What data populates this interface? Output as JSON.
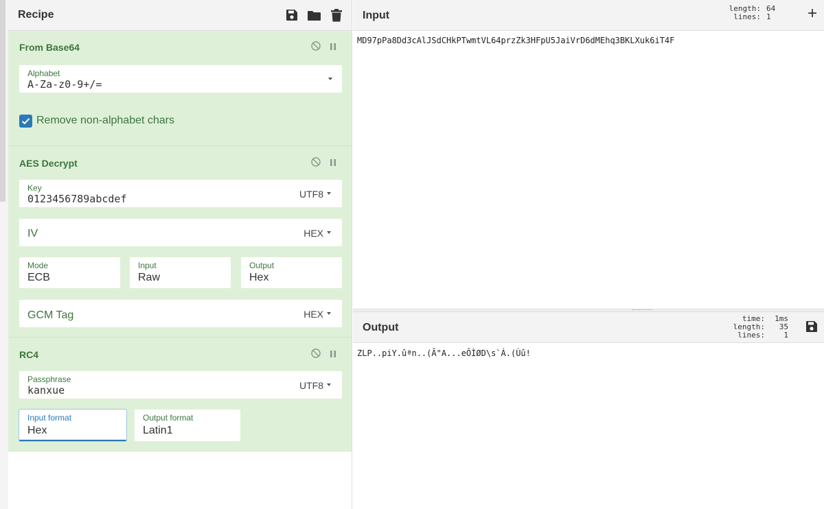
{
  "recipe": {
    "title": "Recipe",
    "header_icons": [
      "save-icon",
      "folder-icon",
      "trash-icon"
    ],
    "operations": {
      "from_base64": {
        "title": "From Base64",
        "alphabet_label": "Alphabet",
        "alphabet_value": "A-Za-z0-9+/=",
        "remove_nonalpha_label": "Remove non-alphabet chars",
        "remove_nonalpha_checked": true
      },
      "aes_decrypt": {
        "title": "AES Decrypt",
        "key_label": "Key",
        "key_value": "0123456789abcdef",
        "key_format": "UTF8",
        "iv_placeholder": "IV",
        "iv_format": "HEX",
        "mode_label": "Mode",
        "mode_value": "ECB",
        "input_label": "Input",
        "input_value": "Raw",
        "output_label": "Output",
        "output_value": "Hex",
        "gcm_placeholder": "GCM Tag",
        "gcm_format": "HEX"
      },
      "rc4": {
        "title": "RC4",
        "passphrase_label": "Passphrase",
        "passphrase_value": "kanxue",
        "passphrase_format": "UTF8",
        "input_format_label": "Input format",
        "input_format_value": "Hex",
        "output_format_label": "Output format",
        "output_format_value": "Latin1"
      }
    }
  },
  "input": {
    "title": "Input",
    "length_label": "length:",
    "length_value": "64",
    "lines_label": "lines:",
    "lines_value": "1",
    "text": "MD97pPa8Dd3cAlJSdCHkPTwmtVL64przZk3HFpU5JaiVrD6dMEhq3BKLXuk6iT4F"
  },
  "output": {
    "title": "Output",
    "time_label": "time:",
    "time_value": "1ms",
    "length_label": "length:",
    "length_value": "35",
    "lines_label": "lines:",
    "lines_value": "1",
    "text": "ZLP..piY.ûªn..(Ã\"A...eÔÌØD\\s`Á.(Ùû!"
  },
  "colors": {
    "op_bg": "#dff0d8",
    "op_text": "#3c763d",
    "accent": "#2a7ab8",
    "header_bg": "#f3f3f3"
  }
}
